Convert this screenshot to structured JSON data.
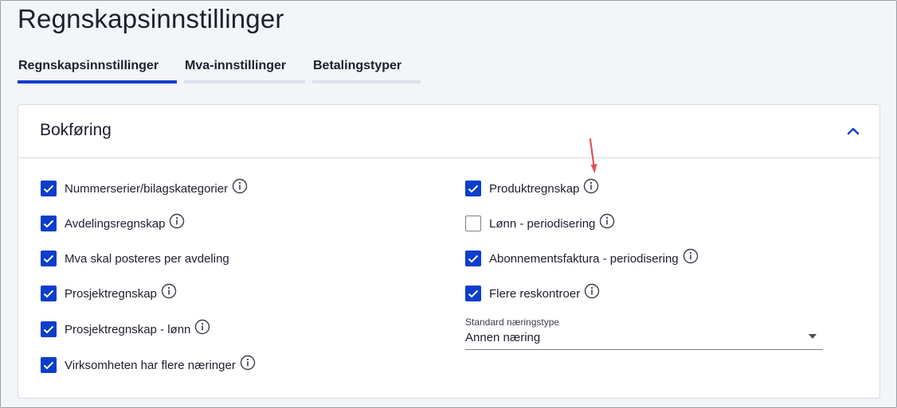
{
  "page": {
    "title": "Regnskapsinnstillinger"
  },
  "tabs": [
    {
      "label": "Regnskapsinnstillinger",
      "active": true
    },
    {
      "label": "Mva-innstillinger",
      "active": false
    },
    {
      "label": "Betalingstyper",
      "active": false
    }
  ],
  "section": {
    "title": "Bokføring",
    "collapse_icon": "chevron-up-icon"
  },
  "left_options": [
    {
      "label": "Nummerserier/bilagskategorier",
      "checked": true,
      "info": true
    },
    {
      "label": "Avdelingsregnskap",
      "checked": true,
      "info": true
    },
    {
      "label": "Mva skal posteres per avdeling",
      "checked": true,
      "info": false
    },
    {
      "label": "Prosjektregnskap",
      "checked": true,
      "info": true
    },
    {
      "label": "Prosjektregnskap - lønn",
      "checked": true,
      "info": true
    },
    {
      "label": "Virksomheten har flere næringer",
      "checked": true,
      "info": true
    }
  ],
  "right_options": [
    {
      "label": "Produktregnskap",
      "checked": true,
      "info": true
    },
    {
      "label": "Lønn - periodisering",
      "checked": false,
      "info": true
    },
    {
      "label": "Abonnementsfaktura - periodisering",
      "checked": true,
      "info": true
    },
    {
      "label": "Flere reskontroer",
      "checked": true,
      "info": true
    }
  ],
  "industry_select": {
    "label": "Standard næringstype",
    "value": "Annen næring"
  },
  "colors": {
    "accent": "#0b3ecb",
    "annotation_arrow": "#e0525e"
  }
}
